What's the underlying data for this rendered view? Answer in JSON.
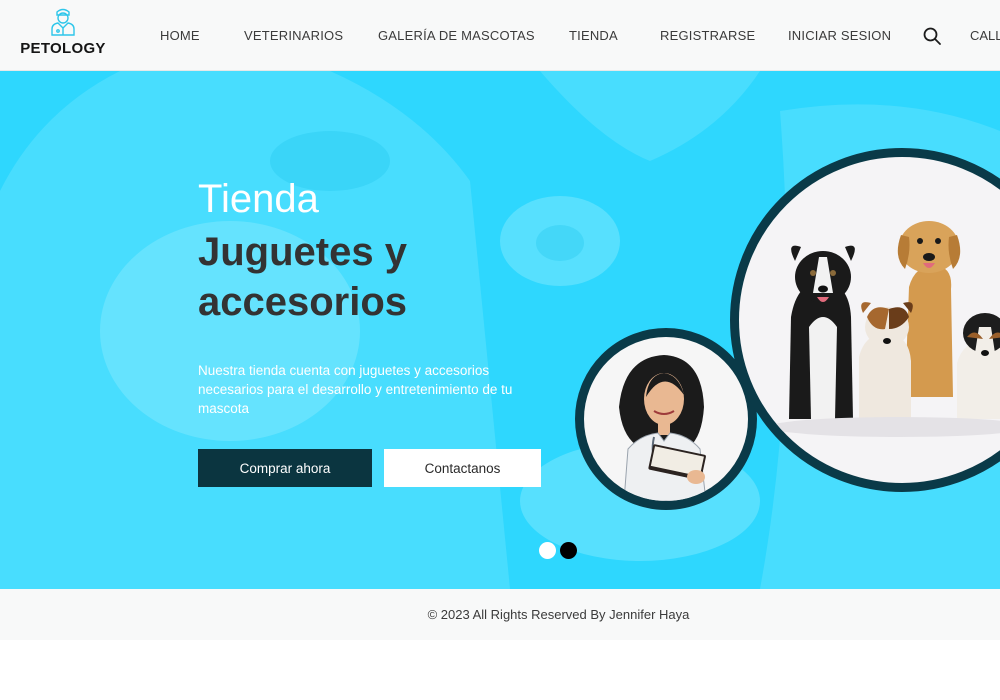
{
  "brand": {
    "name": "PETOLOGY",
    "icon": "veterinarian-icon"
  },
  "nav": {
    "items": [
      {
        "label": "HOME"
      },
      {
        "label": "VETERINARIOS"
      },
      {
        "label": "GALERÍA DE MASCOTAS"
      },
      {
        "label": "TIENDA"
      },
      {
        "label": "REGISTRARSE"
      },
      {
        "label": "INICIAR SESION"
      }
    ],
    "search_icon": "search-icon",
    "call_label": "CALL"
  },
  "hero": {
    "title": "Tienda",
    "heading": "Juguetes y accesorios",
    "description": "Nuestra tienda cuenta con juguetes y accesorios necesarios para el desarrollo y entretenimiento de tu mascota",
    "primary_button": "Comprar ahora",
    "secondary_button": "Contactanos",
    "carousel": {
      "slides": 2,
      "active": 2
    }
  },
  "footer": {
    "text": "© 2023 All Rights Reserved By Jennifer Haya"
  },
  "colors": {
    "hero_bg": "#2ed7fe",
    "dark_accent": "#0b3540",
    "heading_text": "#333333",
    "nav_bg": "#f8f9f9"
  }
}
